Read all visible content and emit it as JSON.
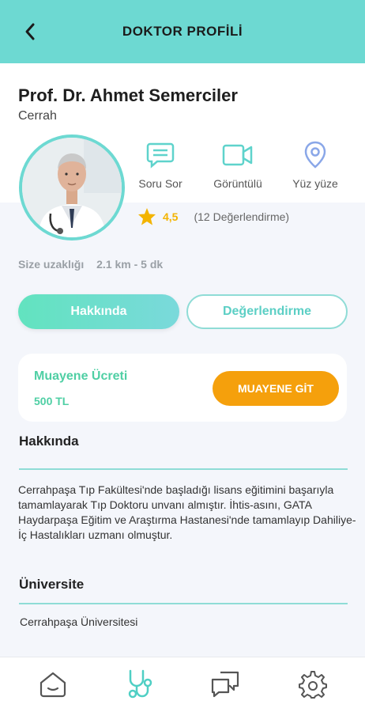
{
  "header": {
    "title": "DOKTOR PROFİLİ",
    "back_icon": "arrow-left-icon"
  },
  "doctor": {
    "name": "Prof. Dr. Ahmet Semerciler",
    "specialty": "Cerrah",
    "actions": [
      {
        "label": "Soru Sor",
        "icon": "chat-icon"
      },
      {
        "label": "Görüntülü",
        "icon": "video-icon"
      },
      {
        "label": "Yüz yüze",
        "icon": "location-pin-icon"
      }
    ],
    "rating": {
      "value": "4,5",
      "count_text": "(12 Değerlendirme)"
    },
    "distance": {
      "label": "Size uzaklığı",
      "value": "2.1 km - 5 dk"
    }
  },
  "tabs": {
    "about": "Hakkında",
    "reviews": "Değerlendirme"
  },
  "fee": {
    "title": "Muayene Ücreti",
    "amount": "500 TL",
    "button": "MUAYENE GİT"
  },
  "about": {
    "title": "Hakkında",
    "text": "Cerrahpaşa Tıp Fakültesi'nde başladığı lisans eğitimini başarıyla tamamlayarak Tıp Doktoru unvanı almıştır. İhtis-asını, GATA Haydarpaşa Eğitim ve Araştırma Hastanesi'nde tamamlayıp Dahiliye-İç Hastalıkları uzmanı olmuştur."
  },
  "university": {
    "title": "Üniversite",
    "value": "Cerrahpaşa Üniversitesi"
  },
  "nav": [
    "home-icon",
    "stethoscope-icon",
    "messages-icon",
    "settings-icon"
  ],
  "colors": {
    "teal": "#6dd9d2",
    "green": "#4fcfa4",
    "orange": "#f5a00c",
    "star": "#f3b400"
  }
}
